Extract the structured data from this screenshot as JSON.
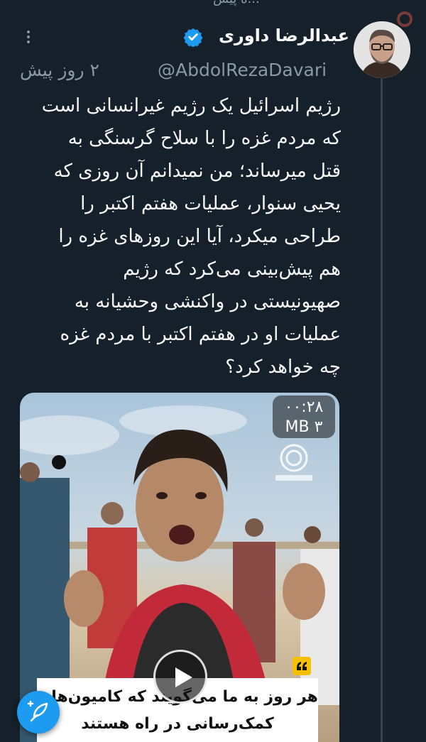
{
  "top_strip": {
    "text": "...ه پیش"
  },
  "tweet": {
    "author_name": "عبدالرضا داوری",
    "handle": "@AbdolRezaDavari",
    "time_ago": "۲ روز پیش",
    "verified": true,
    "text": "رژیم اسرائیل یک رژیم غیرانسانی است که مردم غزه را با سلاح گرسنگی به قتل میرساند؛ من نمیدانم آن روزی که  یحیی سنوار، عملیات هفتم اکتبر را طراحی میکرد، آیا این روزهای غزه را هم پیش‌بینی می‌کرد که رژیم صهیونیستی در واکنشی وحشیانه به عملیات او در هفتم اکتبر با مردم غزه چه خواهد کرد؟"
  },
  "media": {
    "duration": "۰۰:۲۸",
    "size": "۳ MB",
    "caption_line1": "هر روز به ما می‌گویند که کامیون‌های",
    "caption_line2": "کمک‌رسانی در راه هستند"
  },
  "colors": {
    "background": "#15202b",
    "secondary_text": "#8b98a5",
    "accent": "#1d9bf0",
    "thread_line": "#38444d"
  },
  "icons": {
    "more": "more-vertical-icon",
    "verified": "verified-badge-icon",
    "play": "play-icon",
    "compose": "compose-feather-icon",
    "quote": "quote-icon"
  }
}
